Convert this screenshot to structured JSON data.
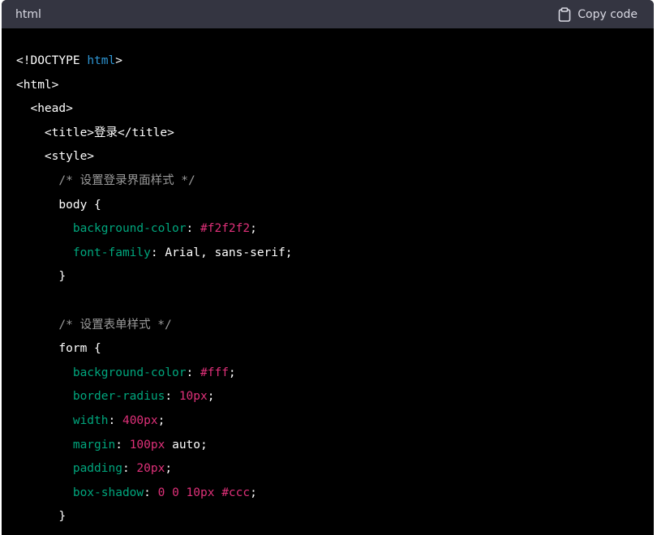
{
  "header": {
    "language_label": "html",
    "copy_label": "Copy code",
    "copy_icon": "clipboard-icon"
  },
  "colors": {
    "header_bg": "#343541",
    "code_bg": "#000000",
    "comment": "#9a9a9a",
    "property": "#00a67d",
    "value": "#df3079",
    "keyword": "#2e95d3"
  },
  "code_lines": [
    {
      "indent": "",
      "tokens": [
        {
          "t": "<!DOCTYPE ",
          "c": "t-plain"
        },
        {
          "t": "html",
          "c": "t-attrname"
        },
        {
          "t": ">",
          "c": "t-plain"
        }
      ]
    },
    {
      "indent": "",
      "tokens": [
        {
          "t": "<html>",
          "c": "t-tag"
        }
      ]
    },
    {
      "indent": "  ",
      "tokens": [
        {
          "t": "<head>",
          "c": "t-tag"
        }
      ]
    },
    {
      "indent": "    ",
      "tokens": [
        {
          "t": "<title>登录</title>",
          "c": "t-tag"
        }
      ]
    },
    {
      "indent": "    ",
      "tokens": [
        {
          "t": "<style>",
          "c": "t-tag"
        }
      ]
    },
    {
      "indent": "      ",
      "tokens": [
        {
          "t": "/* 设置登录界面样式 */",
          "c": "t-comment"
        }
      ]
    },
    {
      "indent": "      ",
      "tokens": [
        {
          "t": "body {",
          "c": "t-plain"
        }
      ]
    },
    {
      "indent": "        ",
      "tokens": [
        {
          "t": "background-color",
          "c": "t-prop"
        },
        {
          "t": ": ",
          "c": "t-punct"
        },
        {
          "t": "#f2f2f2",
          "c": "t-value"
        },
        {
          "t": ";",
          "c": "t-punct"
        }
      ]
    },
    {
      "indent": "        ",
      "tokens": [
        {
          "t": "font-family",
          "c": "t-prop"
        },
        {
          "t": ": Arial, sans-serif;",
          "c": "t-punct"
        }
      ]
    },
    {
      "indent": "      ",
      "tokens": [
        {
          "t": "}",
          "c": "t-plain"
        }
      ]
    },
    {
      "indent": "",
      "tokens": []
    },
    {
      "indent": "      ",
      "tokens": [
        {
          "t": "/* 设置表单样式 */",
          "c": "t-comment"
        }
      ]
    },
    {
      "indent": "      ",
      "tokens": [
        {
          "t": "form {",
          "c": "t-plain"
        }
      ]
    },
    {
      "indent": "        ",
      "tokens": [
        {
          "t": "background-color",
          "c": "t-prop"
        },
        {
          "t": ": ",
          "c": "t-punct"
        },
        {
          "t": "#fff",
          "c": "t-value"
        },
        {
          "t": ";",
          "c": "t-punct"
        }
      ]
    },
    {
      "indent": "        ",
      "tokens": [
        {
          "t": "border-radius",
          "c": "t-prop"
        },
        {
          "t": ": ",
          "c": "t-punct"
        },
        {
          "t": "10px",
          "c": "t-value"
        },
        {
          "t": ";",
          "c": "t-punct"
        }
      ]
    },
    {
      "indent": "        ",
      "tokens": [
        {
          "t": "width",
          "c": "t-prop"
        },
        {
          "t": ": ",
          "c": "t-punct"
        },
        {
          "t": "400px",
          "c": "t-value"
        },
        {
          "t": ";",
          "c": "t-punct"
        }
      ]
    },
    {
      "indent": "        ",
      "tokens": [
        {
          "t": "margin",
          "c": "t-prop"
        },
        {
          "t": ": ",
          "c": "t-punct"
        },
        {
          "t": "100px",
          "c": "t-value"
        },
        {
          "t": " auto;",
          "c": "t-punct"
        }
      ]
    },
    {
      "indent": "        ",
      "tokens": [
        {
          "t": "padding",
          "c": "t-prop"
        },
        {
          "t": ": ",
          "c": "t-punct"
        },
        {
          "t": "20px",
          "c": "t-value"
        },
        {
          "t": ";",
          "c": "t-punct"
        }
      ]
    },
    {
      "indent": "        ",
      "tokens": [
        {
          "t": "box-shadow",
          "c": "t-prop"
        },
        {
          "t": ": ",
          "c": "t-punct"
        },
        {
          "t": "0 0 10px #ccc",
          "c": "t-value"
        },
        {
          "t": ";",
          "c": "t-punct"
        }
      ]
    },
    {
      "indent": "      ",
      "tokens": [
        {
          "t": "}",
          "c": "t-plain"
        }
      ]
    }
  ]
}
